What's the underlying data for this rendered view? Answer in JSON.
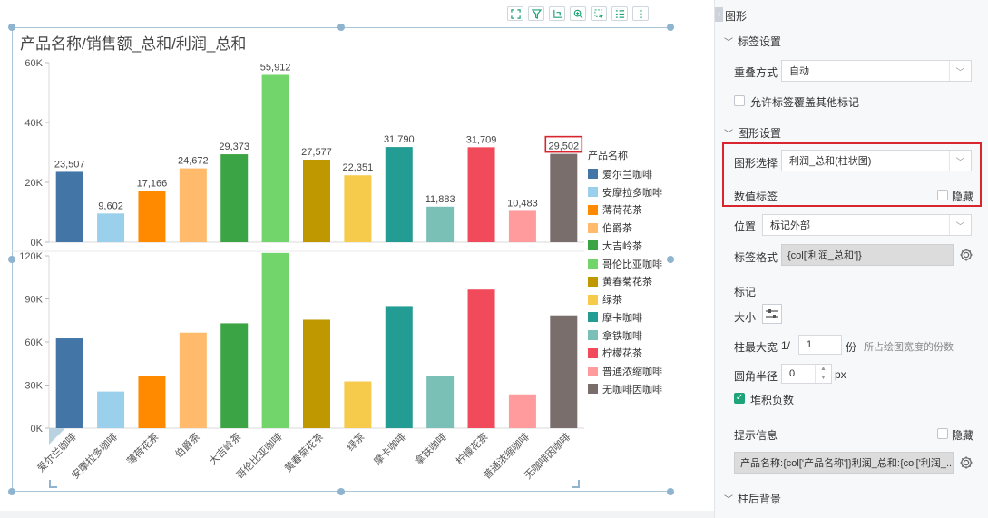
{
  "toolbar": {
    "icons": [
      "fullscreen-icon",
      "filter-icon",
      "drill-icon",
      "zoom-in-icon",
      "select-icon",
      "list-icon",
      "more-icon"
    ]
  },
  "chart": {
    "title": "产品名称/销售额_总和/利润_总和",
    "legend_title": "产品名称",
    "highlight_label": "29,502",
    "highlight_color": "#d9262e"
  },
  "chart_data": {
    "type": "bar",
    "categories": [
      "爱尔兰咖啡",
      "安摩拉多咖啡",
      "薄荷花茶",
      "伯爵茶",
      "大吉岭茶",
      "哥伦比亚咖啡",
      "黄春菊花茶",
      "绿茶",
      "摩卡咖啡",
      "拿铁咖啡",
      "柠檬花茶",
      "普通浓缩咖啡",
      "无咖啡因咖啡"
    ],
    "colors": [
      "#4376a6",
      "#9bd0ec",
      "#ff8a00",
      "#ffbb6b",
      "#3ba445",
      "#72d56c",
      "#bf9800",
      "#f6ca4a",
      "#239c93",
      "#7bc0b7",
      "#f04a5b",
      "#ff9b9d",
      "#7a6e6c"
    ],
    "series": [
      {
        "name": "利润_总和",
        "values": [
          23507,
          9602,
          17166,
          24672,
          29373,
          55912,
          27577,
          22351,
          31790,
          11883,
          31709,
          10483,
          29502
        ],
        "labels": [
          "23,507",
          "9,602",
          "17,166",
          "24,672",
          "29,373",
          "55,912",
          "27,577",
          "22,351",
          "31,790",
          "11,883",
          "31,709",
          "10,483",
          "29,502"
        ],
        "ylim": [
          0,
          60000
        ],
        "ticks": [
          0,
          20000,
          40000,
          60000
        ],
        "tick_labels": [
          "0K",
          "20K",
          "40K",
          "60K"
        ]
      },
      {
        "name": "销售额_总和",
        "values": [
          62500,
          25500,
          36000,
          66500,
          73000,
          122000,
          75500,
          32500,
          85000,
          36000,
          96500,
          23500,
          78500
        ],
        "ylim": [
          0,
          120000
        ],
        "ticks": [
          0,
          30000,
          60000,
          90000,
          120000
        ],
        "tick_labels": [
          "0K",
          "30K",
          "60K",
          "90K",
          "120K"
        ]
      }
    ],
    "grid": false,
    "legend_position": "right"
  },
  "panel": {
    "title": "图形",
    "label_settings": {
      "section": "标签设置",
      "overlap_label": "重叠方式",
      "overlap_value": "自动",
      "allow_cover_label": "允许标签覆盖其他标记"
    },
    "shape_settings": {
      "section": "图形设置",
      "shape_select_label": "图形选择",
      "shape_select_value": "利润_总和(柱状图)",
      "value_label": "数值标签",
      "hide_label": "隐藏",
      "position_label": "位置",
      "position_value": "标记外部",
      "format_label": "标签格式",
      "format_value": "{col['利润_总和']}",
      "mark_label": "标记",
      "size_label": "大小",
      "bar_width_label": "柱最大宽",
      "bar_width_prefix": "1/",
      "bar_width_value": "1",
      "bar_width_unit": "份",
      "bar_width_hint": "所占绘图宽度的份数",
      "radius_label": "圆角半径",
      "radius_value": "0",
      "radius_unit": "px",
      "stack_negative_label": "堆积负数",
      "stack_negative_checked": true,
      "tooltip_label": "提示信息",
      "tooltip_hide_label": "隐藏",
      "tooltip_value": "产品名称:{col['产品名称']}利润_总和:{col['利润_..."
    },
    "bar_background": {
      "section": "柱后背景"
    }
  }
}
